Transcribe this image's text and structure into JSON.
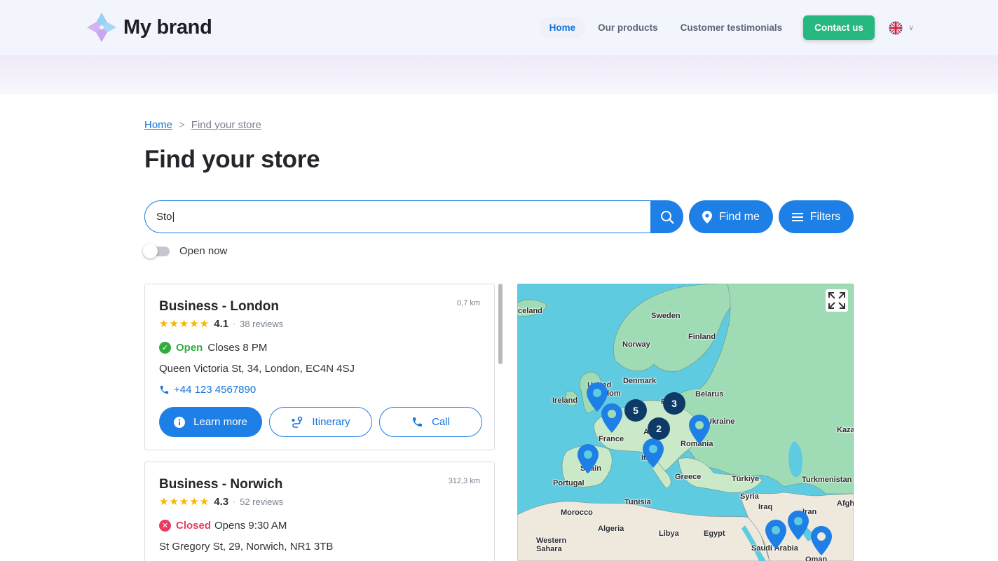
{
  "header": {
    "brand": "My brand",
    "nav": [
      {
        "label": "Home",
        "active": true
      },
      {
        "label": "Our products",
        "active": false
      },
      {
        "label": "Customer testimonials",
        "active": false
      }
    ],
    "contact_label": "Contact us",
    "language_icon": "uk-flag-icon"
  },
  "breadcrumb": {
    "home": "Home",
    "separator": ">",
    "current": "Find your store"
  },
  "page": {
    "title": "Find your store"
  },
  "search": {
    "value": "Sto|",
    "find_me_label": "Find me",
    "filters_label": "Filters",
    "open_now_label": "Open now",
    "open_now_on": false
  },
  "stores": [
    {
      "name": "Business - London",
      "distance": "0,7 km",
      "stars": "★★★★★",
      "rating": "4.1",
      "dot": "·",
      "reviews": "38 reviews",
      "status": "Open",
      "status_detail": "Closes 8 PM",
      "address": "Queen Victoria St, 34, London, EC4N 4SJ",
      "phone": "+44 123 4567890",
      "actions": [
        "Learn more",
        "Itinerary",
        "Call"
      ]
    },
    {
      "name": "Business - Norwich",
      "distance": "312,3 km",
      "stars": "★★★★★",
      "rating": "4.3",
      "dot": "·",
      "reviews": "52 reviews",
      "status": "Closed",
      "status_detail": "Opens 9:30 AM",
      "address": "St Gregory St, 29, Norwich, NR1 3TB"
    }
  ],
  "map": {
    "labels": [
      "Iceland",
      "Sweden",
      "Finland",
      "Norway",
      "Denmark",
      "United Kingdom",
      "Ireland",
      "Belarus",
      "P",
      "Ukraine",
      "Kaza",
      "France",
      "A",
      "Romania",
      "Ita",
      "Spain",
      "Portugal",
      "Greece",
      "Türkiye",
      "Turkmenistan",
      "Tunisia",
      "Syria",
      "Afghan",
      "Morocco",
      "Iraq",
      "Iran",
      "Algeria",
      "Libya",
      "Egypt",
      "Western Sahara",
      "Saudi Arabia",
      "Oman"
    ],
    "clusters": [
      "5",
      "3",
      "2"
    ],
    "colors": {
      "sea": "#5fcbe0",
      "land": "#9fdcb6",
      "pin": "#1e80e6",
      "cluster": "#0e3a68"
    }
  }
}
